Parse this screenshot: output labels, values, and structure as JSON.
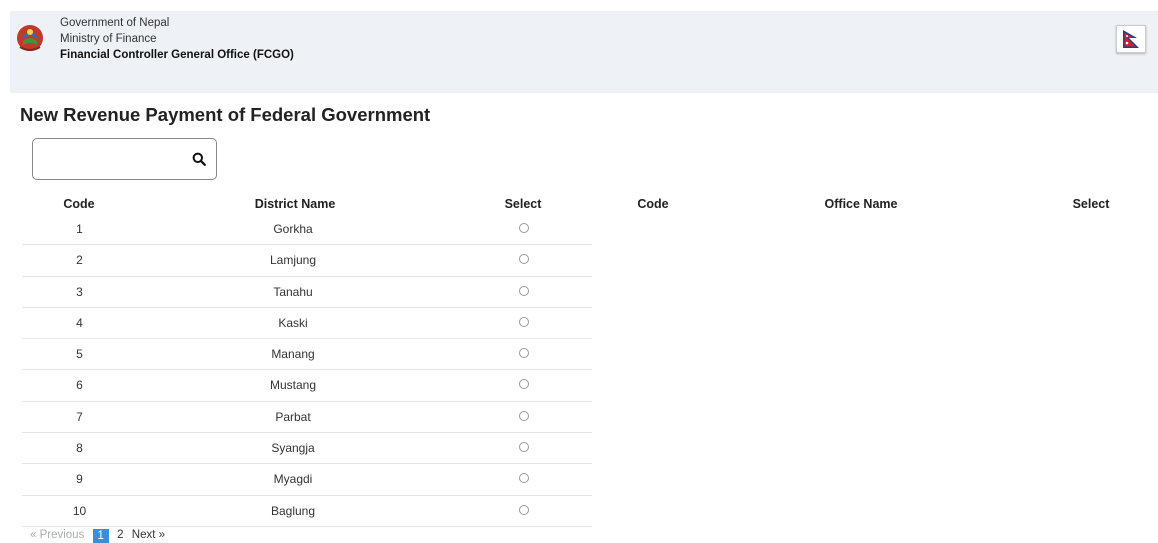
{
  "header": {
    "line1": "Government of Nepal",
    "line2": "Ministry of Finance",
    "line3": "Financial Controller General Office (FCGO)"
  },
  "page": {
    "title": "New Revenue Payment of Federal Government"
  },
  "search": {
    "placeholder": "",
    "value": ""
  },
  "district_table": {
    "headers": {
      "code": "Code",
      "name": "District Name",
      "select": "Select"
    },
    "rows": [
      {
        "code": "1",
        "name": "Gorkha"
      },
      {
        "code": "2",
        "name": "Lamjung"
      },
      {
        "code": "3",
        "name": "Tanahu"
      },
      {
        "code": "4",
        "name": "Kaski"
      },
      {
        "code": "5",
        "name": "Manang"
      },
      {
        "code": "6",
        "name": "Mustang"
      },
      {
        "code": "7",
        "name": "Parbat"
      },
      {
        "code": "8",
        "name": "Syangja"
      },
      {
        "code": "9",
        "name": "Myagdi"
      },
      {
        "code": "10",
        "name": "Baglung"
      }
    ]
  },
  "office_table": {
    "headers": {
      "code": "Code",
      "name": "Office Name",
      "select": "Select"
    }
  },
  "pagination": {
    "previous": "« Previous",
    "pages": [
      "1",
      "2"
    ],
    "active_page": "1",
    "next": "Next »"
  },
  "colors": {
    "header_bg": "#eef1f5",
    "active_page_bg": "#3c8fd6"
  }
}
